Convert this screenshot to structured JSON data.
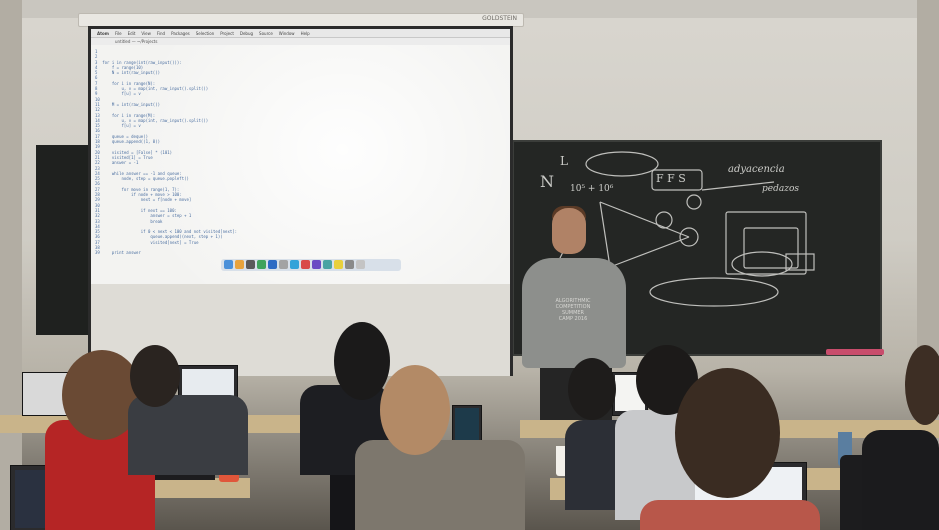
{
  "colors": {
    "wall": "#d9d6cf",
    "blackboard": "#242624",
    "projection": "#f3f3f1",
    "code_text": "#4a6ea0",
    "presenter_shirt": "#8d8f8c",
    "desk": "#c9b48a"
  },
  "projector_rail_label": "GOLDSTEIN",
  "projection": {
    "menu": [
      "Atom",
      "File",
      "Edit",
      "View",
      "Find",
      "Packages",
      "Selection",
      "Project",
      "Debug",
      "Source",
      "Window",
      "Help"
    ],
    "tab_label": "untitled — ~/Projects",
    "code_lines": [
      "1",
      "2",
      "3  for i in range(int(raw_input())):",
      "4      f = range(10)",
      "5      N = int(raw_input())",
      "6",
      "7      for i in range(N):",
      "8          u, v = map(int, raw_input().split())",
      "9          f[u] = v",
      "10",
      "11     M = int(raw_input())",
      "12",
      "13     for i in range(M):",
      "14         u, v = map(int, raw_input().split())",
      "15         f[u] = v",
      "16",
      "17     queue = deque()",
      "18     queue.append((1, 0))",
      "19",
      "20     visited = [False] * (101)",
      "21     visited[1] = True",
      "22     answer = -1",
      "23",
      "24     while answer == -1 and queue:",
      "25         node, step = queue.popleft()",
      "26",
      "27         for move in range(1, 7):",
      "28             if node + move > 100:",
      "29                 next = f[node + move]",
      "30",
      "31                 if next == 100:",
      "32                     answer = step + 1",
      "33                     break",
      "34",
      "35                 if 0 < next < 100 and not visited[next]:",
      "36                     queue.append((next, step + 1))",
      "37                     visited[next] = True",
      "38",
      "39     print answer"
    ]
  },
  "blackboard": {
    "notes": [
      "N",
      "L",
      "10⁵ + 10⁶",
      "F F S",
      "adyacencia",
      "pedazos"
    ]
  },
  "presenter_shirt_text": [
    "ALGORITHMIC",
    "COMPETITION",
    "SUMMER",
    "CAMP 2016"
  ]
}
